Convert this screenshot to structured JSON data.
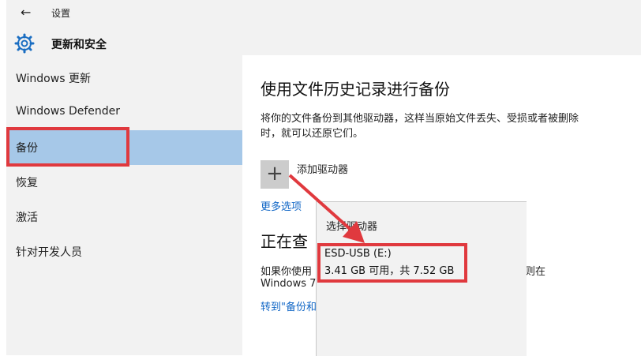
{
  "window": {
    "back_glyph": "←",
    "title": "设置"
  },
  "section": {
    "icon": "gear-icon",
    "title": "更新和安全"
  },
  "sidebar": {
    "items": [
      {
        "label": "Windows 更新"
      },
      {
        "label": "Windows Defender"
      },
      {
        "label": "备份",
        "selected": true
      },
      {
        "label": "恢复"
      },
      {
        "label": "激活"
      },
      {
        "label": "针对开发人员"
      }
    ]
  },
  "main": {
    "heading": "使用文件历史记录进行备份",
    "description": "将你的文件备份到其他驱动器，这样当原始文件丢失、受损或者被删除时，就可以还原它们。",
    "add_drive_icon": "+",
    "add_drive_label": "添加驱动器",
    "more_options": "更多选项",
    "heading2": "正在查",
    "body_line1": "如果你使用",
    "body_line1_end": "则在",
    "body_line2": "Windows 7",
    "goto_link": "转到\"备份和"
  },
  "popup": {
    "title": "选择驱动器",
    "drive_name": "ESD-USB (E:)",
    "drive_info": "3.41 GB 可用，共 7.52 GB"
  },
  "colors": {
    "selected_bg": "#a6c8e8",
    "annotation_red": "#e0393e",
    "link": "#1066c6"
  }
}
